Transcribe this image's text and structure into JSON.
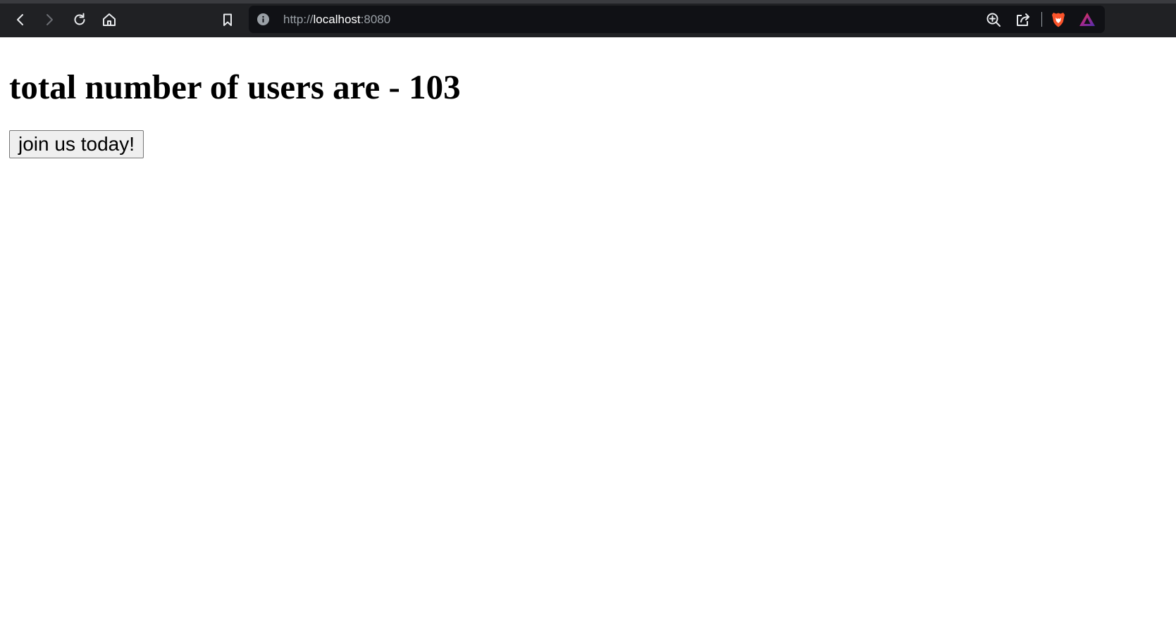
{
  "browser": {
    "url": {
      "scheme": "http://",
      "host": "localhost",
      "port": ":8080"
    },
    "icons": {
      "back": "chevron-left",
      "forward": "chevron-right",
      "reload": "reload",
      "home": "home",
      "bookmark": "bookmark",
      "info": "info",
      "zoom": "zoom-in",
      "share": "share",
      "brave": "brave-lion",
      "rewards": "brave-rewards-triangle"
    },
    "colors": {
      "toolbar": "#202124",
      "omnibox": "#101115",
      "brave": "#fb542b"
    }
  },
  "page": {
    "headline": "total number of users are - 103",
    "button_label": "join us today!"
  }
}
